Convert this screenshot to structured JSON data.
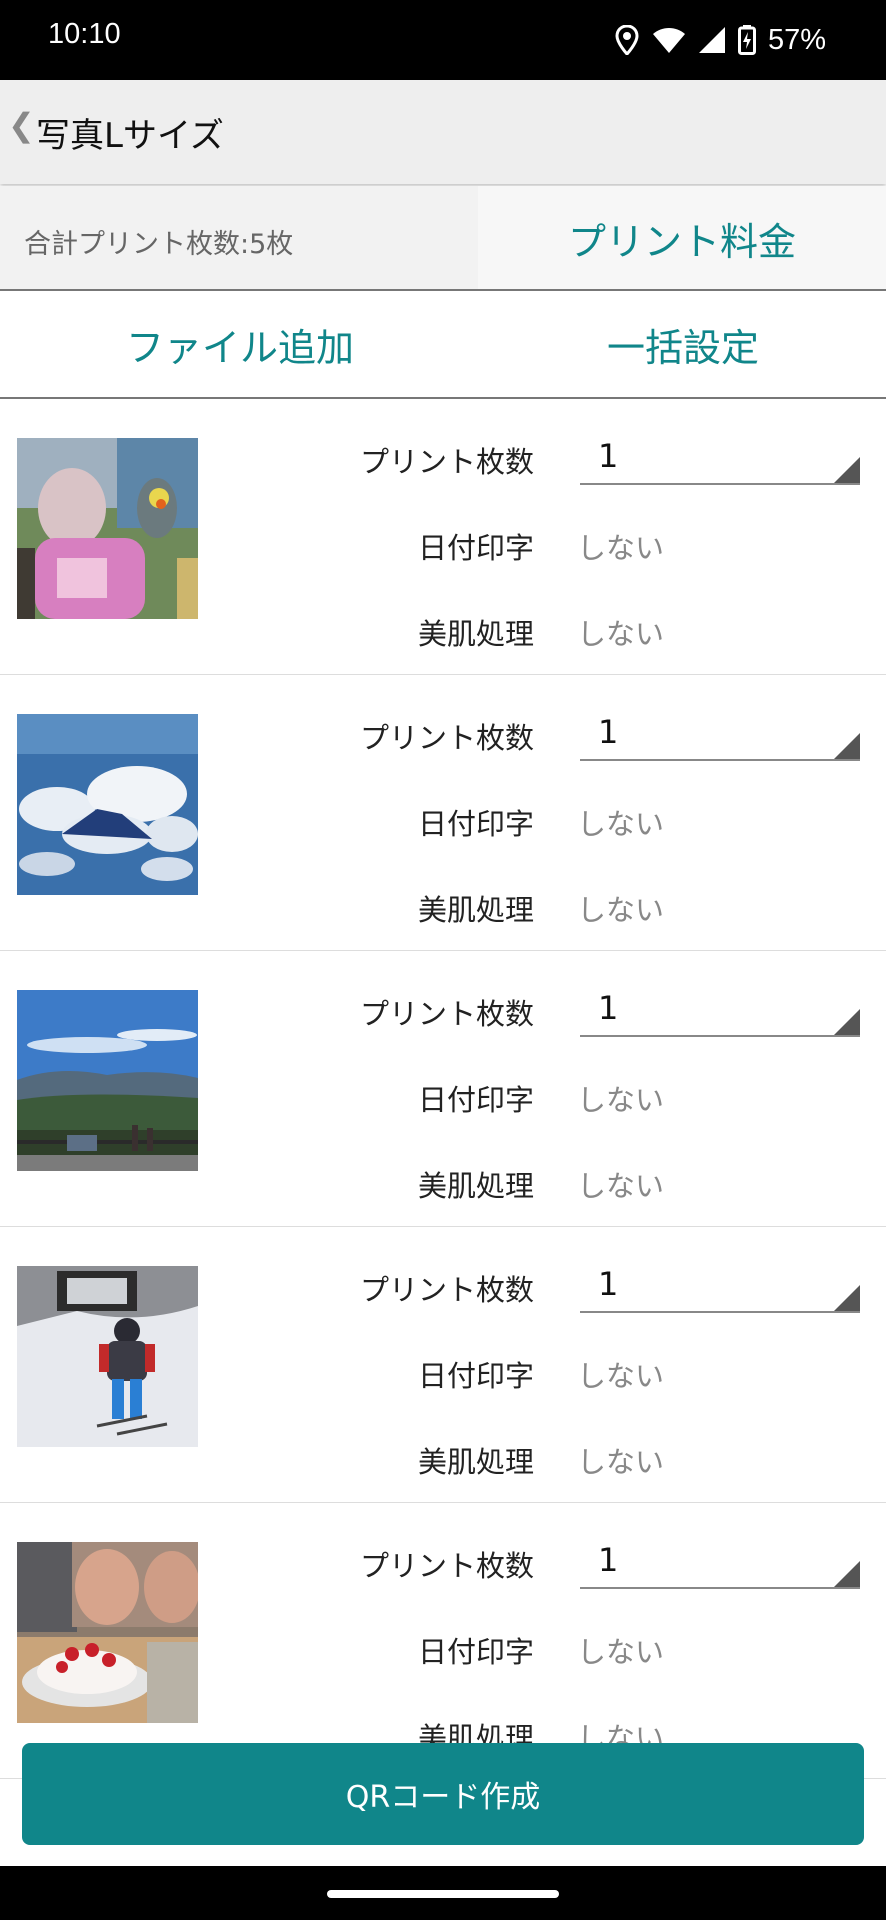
{
  "status": {
    "time": "10:10",
    "battery": "57%",
    "icons": [
      "location-icon",
      "wifi-icon",
      "signal-icon",
      "battery-charging-icon"
    ]
  },
  "appbar": {
    "back_glyph": "❮",
    "title": "写真Lサイズ"
  },
  "summary": {
    "count_text": "合計プリント枚数:5枚",
    "price_label": "プリント料金"
  },
  "actions": {
    "add_file": "ファイル追加",
    "bulk_settings": "一括設定"
  },
  "labels": {
    "print_count": "プリント枚数",
    "date_print": "日付印字",
    "skin": "美肌処理"
  },
  "items": [
    {
      "photo": "girl-with-parrot",
      "count": "1",
      "date": "しない",
      "skin": "しない"
    },
    {
      "photo": "mountain-above-clouds",
      "count": "1",
      "date": "しない",
      "skin": "しない"
    },
    {
      "photo": "mountain-view-sky",
      "count": "1",
      "date": "しない",
      "skin": "しない"
    },
    {
      "photo": "child-skiing",
      "count": "1",
      "date": "しない",
      "skin": "しない"
    },
    {
      "photo": "birthday-cake",
      "count": "1",
      "date": "しない",
      "skin": "しない"
    }
  ],
  "footer": {
    "qr_button": "QRコード作成"
  },
  "colors": {
    "accent": "#10868a",
    "appbar": "#eeeeee"
  }
}
